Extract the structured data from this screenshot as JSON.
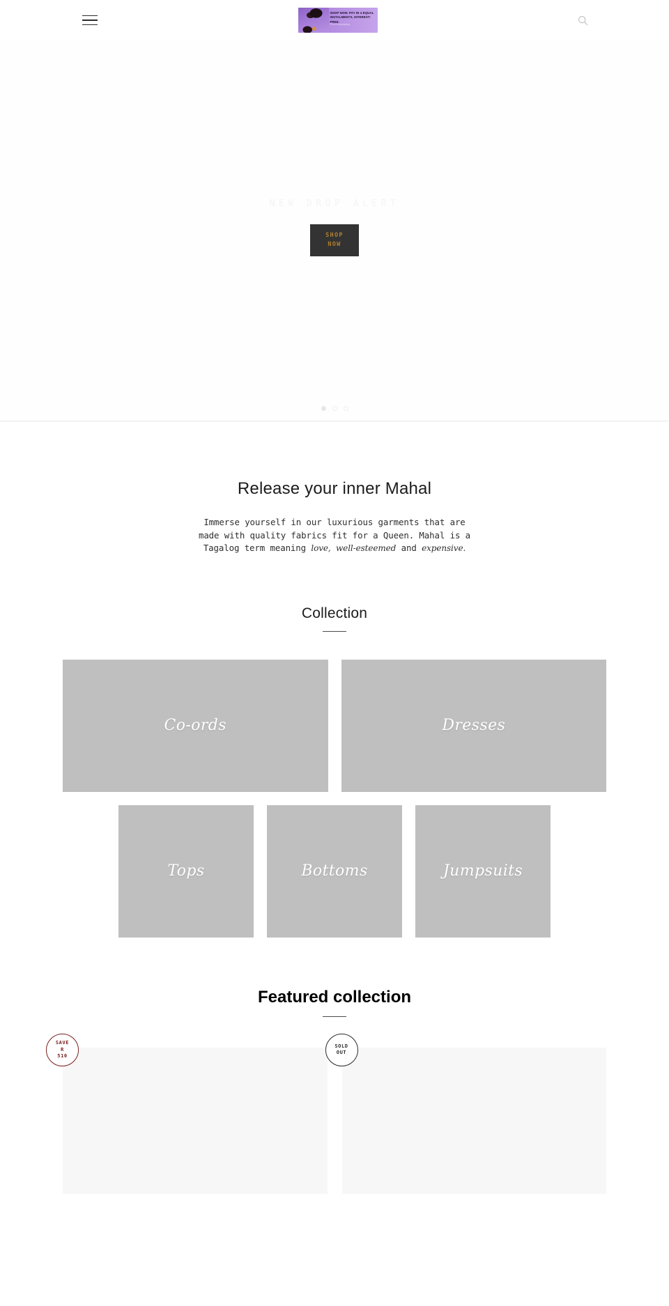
{
  "header": {
    "menu_icon": "hamburger-menu-icon",
    "search_icon": "search-icon",
    "promo": {
      "line1": "SHOP NOW. PAY IN 4 EQUAL",
      "line2": "INSTALMENTS, INTEREST-FREE.",
      "sub": "Pre-k shopping"
    }
  },
  "hero": {
    "eyebrow": "NEW DROP ALERT",
    "cta_line1": "SHOP",
    "cta_line2": "NOW",
    "dots": [
      "active",
      "inactive",
      "inactive"
    ],
    "cta_bg": "#333333",
    "cta_color": "#b07f33"
  },
  "intro": {
    "heading": "Release your inner Mahal",
    "body_1": "Immerse yourself in our luxurious garments that are made with quality fabrics fit for a Queen. Mahal is a Tagalog term meaning ",
    "italic_1": "love,",
    "italic_2": "well-esteemed",
    "mid": " and ",
    "italic_3": "expensive."
  },
  "collection": {
    "title": "Collection",
    "tiles_top": [
      {
        "label": "Co-ords"
      },
      {
        "label": "Dresses"
      }
    ],
    "tiles_bottom": [
      {
        "label": "Tops"
      },
      {
        "label": "Bottoms"
      },
      {
        "label": "Jumpsuits"
      }
    ]
  },
  "featured": {
    "title": "Featured collection",
    "products": [
      {
        "badge_line1": "SAVE",
        "badge_line2": "R",
        "badge_line3": "510",
        "badge_type": "save"
      },
      {
        "badge_line1": "SOLD",
        "badge_line2": "OUT",
        "badge_line3": "",
        "badge_type": "sold"
      }
    ]
  }
}
